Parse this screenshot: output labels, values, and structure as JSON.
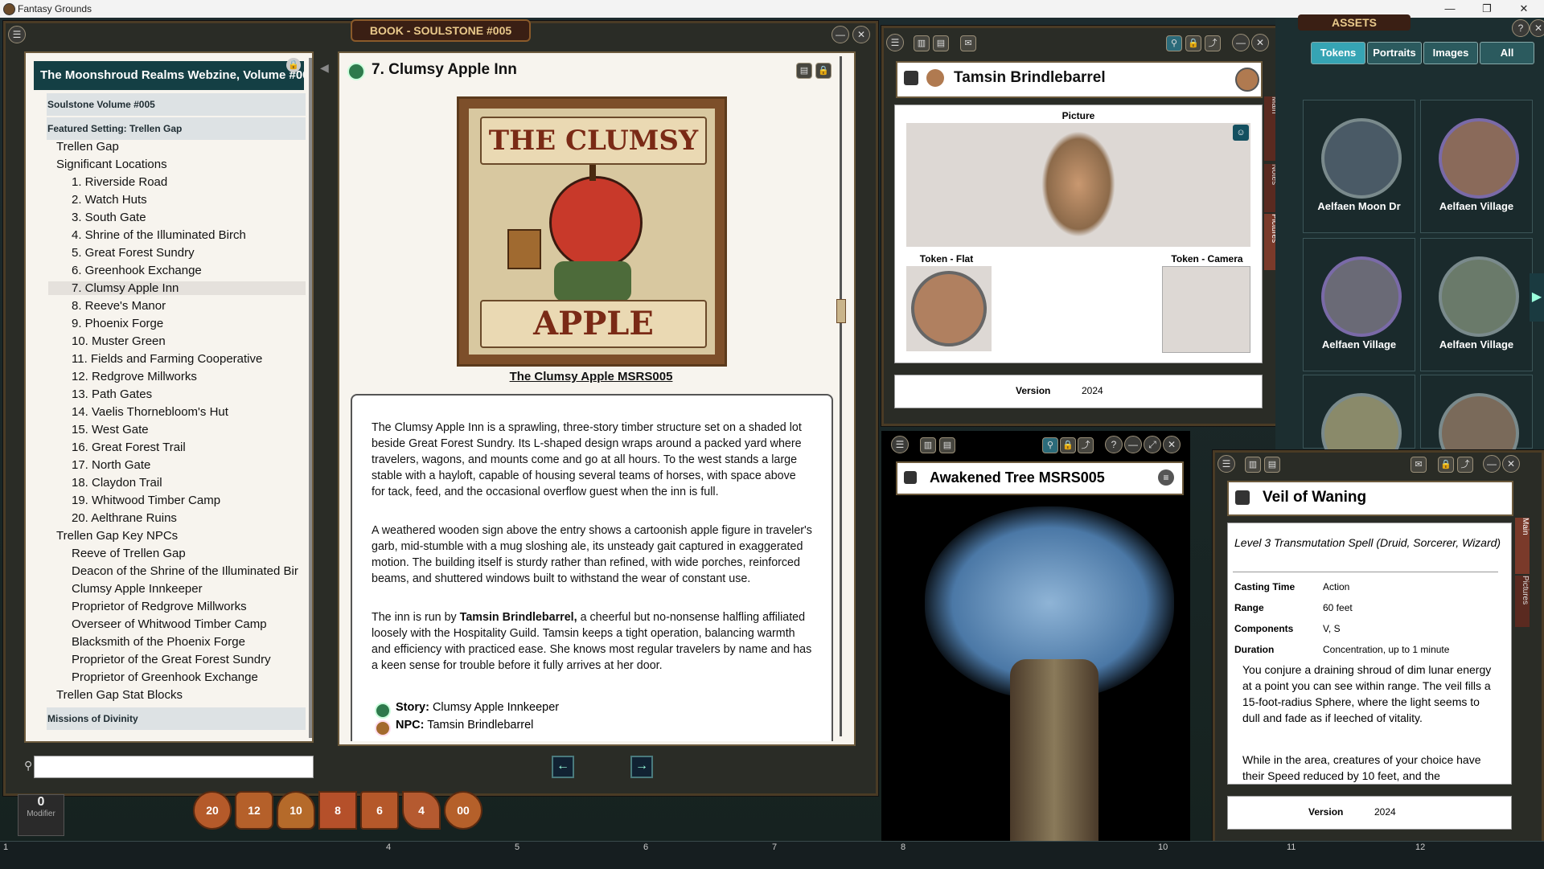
{
  "app": {
    "title": "Fantasy Grounds"
  },
  "book": {
    "window_title": "BOOK - SOULSTONE #005",
    "toc_header": "The Moonshroud Realms Webzine, Volume #00",
    "section1": "Soulstone Volume #005",
    "section2": "Featured Setting: Trellen Gap",
    "section3": "Missions of Divinity",
    "toc_level1": [
      "Trellen Gap",
      "Significant Locations"
    ],
    "locations": [
      "1. Riverside Road",
      "2. Watch Huts",
      "3. South Gate",
      "4. Shrine of the Illuminated Birch",
      "5. Great Forest Sundry",
      "6. Greenhook Exchange",
      "7. Clumsy Apple Inn",
      "8. Reeve's Manor",
      "9. Phoenix Forge",
      "10. Muster Green",
      "11. Fields and Farming Cooperative",
      "12. Redgrove Millworks",
      "13. Path Gates",
      "14. Vaelis Thornebloom's Hut",
      "15. West Gate",
      "16. Great Forest Trail",
      "17. North Gate",
      "18. Claydon Trail",
      "19. Whitwood Timber Camp",
      "20. Aelthrane Ruins"
    ],
    "npcs_header": "Trellen Gap Key NPCs",
    "npcs": [
      "Reeve of Trellen Gap",
      "Deacon of the Shrine of the Illuminated Bir",
      "Clumsy Apple Innkeeper",
      "Proprietor of Redgrove Millworks",
      "Overseer of Whitwood Timber Camp",
      "Blacksmith of the Phoenix Forge",
      "Proprietor of the Great Forest Sundry",
      "Proprietor of Greenhook Exchange"
    ],
    "stat_blocks": "Trellen Gap Stat Blocks",
    "page_title": "7. Clumsy Apple Inn",
    "art_top": "THE CLUMSY",
    "art_bottom": "APPLE",
    "caption": "The Clumsy Apple MSRS005",
    "p1": "The Clumsy Apple Inn is a sprawling, three-story timber structure set on a shaded lot beside Great Forest Sundry. Its L-shaped design wraps around a packed yard where travelers, wagons, and mounts come and go at all hours. To the west stands a large stable with a hayloft, capable of housing several teams of horses, with space above for tack, feed, and the occasional overflow guest when the inn is full.",
    "p2": "A weathered wooden sign above the entry shows a cartoonish apple figure in traveler's garb, mid-stumble with a mug sloshing ale, its unsteady gait captured in exaggerated motion. The building itself is sturdy rather than refined, with wide porches, reinforced beams, and shuttered windows built to withstand the wear of constant use.",
    "p3_a": "The inn is run by ",
    "p3_b": "Tamsin Brindlebarrel,",
    "p3_c": " a cheerful but no-nonsense halfling affiliated loosely with the Hospitality Guild. Tamsin keeps a tight operation, balancing warmth and efficiency with practiced ease. She knows most regular travelers by name and has a keen sense for trouble before it fully arrives at her door.",
    "link1_label": "Story:",
    "link1_value": "Clumsy Apple Innkeeper",
    "link2_label": "NPC:",
    "link2_value": "Tamsin Brindlebarrel",
    "prev": "←",
    "next": "→"
  },
  "npc": {
    "name": "Tamsin Brindlebarrel",
    "picture_label": "Picture",
    "token_flat": "Token - Flat",
    "token_camera": "Token - Camera",
    "version_label": "Version",
    "version": "2024",
    "tabs": [
      "Main",
      "Notes",
      "Pictures"
    ]
  },
  "assets": {
    "title": "ASSETS",
    "tabs": [
      "Tokens",
      "Portraits",
      "Images",
      "All"
    ],
    "tokens": [
      "Aelfaen Moon Dr",
      "Aelfaen Village",
      "Aelfaen Village",
      "Aelfaen Village"
    ]
  },
  "tree": {
    "title": "Awakened Tree MSRS005"
  },
  "spell": {
    "name": "Veil of Waning",
    "subtitle": "Level 3 Transmutation Spell (Druid, Sorcerer, Wizard)",
    "rows": [
      {
        "k": "Casting Time",
        "v": "Action"
      },
      {
        "k": "Range",
        "v": "60 feet"
      },
      {
        "k": "Components",
        "v": "V, S"
      },
      {
        "k": "Duration",
        "v": "Concentration, up to 1 minute"
      }
    ],
    "p1": "You conjure a draining shroud of dim lunar energy at a point you can see within range. The veil fills a 15-foot-radius Sphere, where the light seems to dull and fade as if leeched of vitality.",
    "p2": "While in the area, creatures of your choice have their Speed reduced by 10 feet, and the",
    "version_label": "Version",
    "version": "2024",
    "tabs": [
      "Main",
      "Pictures"
    ]
  },
  "dice": [
    "20",
    "12",
    "10",
    "8",
    "6",
    "4",
    "00"
  ],
  "modifier": {
    "value": "0",
    "label": "Modifier"
  },
  "hotbar": [
    "1",
    "4",
    "5",
    "6",
    "7",
    "8",
    "10",
    "11",
    "12"
  ],
  "colors": {
    "accent": "#36a4b4",
    "dark_teal": "#143f44",
    "parchment": "#f7f4ee",
    "frame": "#4a3b25"
  }
}
